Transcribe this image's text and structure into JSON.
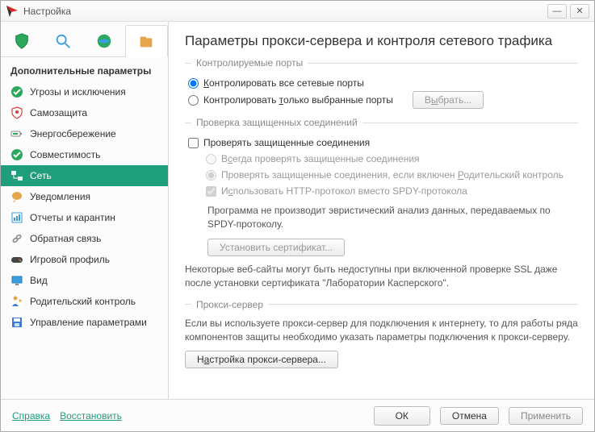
{
  "window": {
    "title": "Настройка"
  },
  "sidebar": {
    "section_title": "Дополнительные параметры",
    "items": [
      {
        "label": "Угрозы и исключения"
      },
      {
        "label": "Самозащита"
      },
      {
        "label": "Энергосбережение"
      },
      {
        "label": "Совместимость"
      },
      {
        "label": "Сеть"
      },
      {
        "label": "Уведомления"
      },
      {
        "label": "Отчеты и карантин"
      },
      {
        "label": "Обратная связь"
      },
      {
        "label": "Игровой профиль"
      },
      {
        "label": "Вид"
      },
      {
        "label": "Родительский контроль"
      },
      {
        "label": "Управление параметрами"
      }
    ]
  },
  "content": {
    "page_title": "Параметры прокси-сервера и контроля сетевого трафика",
    "ports": {
      "legend": "Контролируемые порты",
      "radio_all_pre": "К",
      "radio_all_post": "онтролировать все сетевые порты",
      "radio_selected_pre": "Контролировать ",
      "radio_selected_hot": "т",
      "radio_selected_post": "олько выбранные порты",
      "select_btn_pre": "В",
      "select_btn_hot": "ы",
      "select_btn_post": "брать..."
    },
    "ssl": {
      "legend": "Проверка защищенных соединений",
      "check_main": "Проверять защищенные соединения",
      "radio_always_pre": "В",
      "radio_always_hot": "с",
      "radio_always_post": "егда проверять защищенные соединения",
      "radio_parent_pre": "Проверять защищенные соединения, если включен ",
      "radio_parent_hot": "Р",
      "radio_parent_post": "одительский контроль",
      "check_http_pre": "И",
      "check_http_hot": "с",
      "check_http_post": "пользовать HTTP-протокол вместо SPDY-протокола",
      "spdy_note": "Программа не производит эвристический анализ данных, передаваемых по SPDY-протоколу.",
      "install_btn": "Установить сертификат...",
      "ssl_warning": "Некоторые веб-сайты могут быть недоступны при включенной проверке SSL даже после установки сертификата \"Лаборатории Касперского\"."
    },
    "proxy": {
      "legend": "Прокси-сервер",
      "note": "Если вы используете прокси-сервер для подключения к интернету, то для работы ряда компонентов защиты необходимо указать параметры подключения к прокси-серверу.",
      "btn_pre": "Н",
      "btn_hot": "а",
      "btn_post": "стройка прокси-сервера..."
    }
  },
  "footer": {
    "help": "Справка",
    "restore": "Восстановить",
    "ok": "ОК",
    "cancel": "Отмена",
    "apply": "Применить"
  }
}
